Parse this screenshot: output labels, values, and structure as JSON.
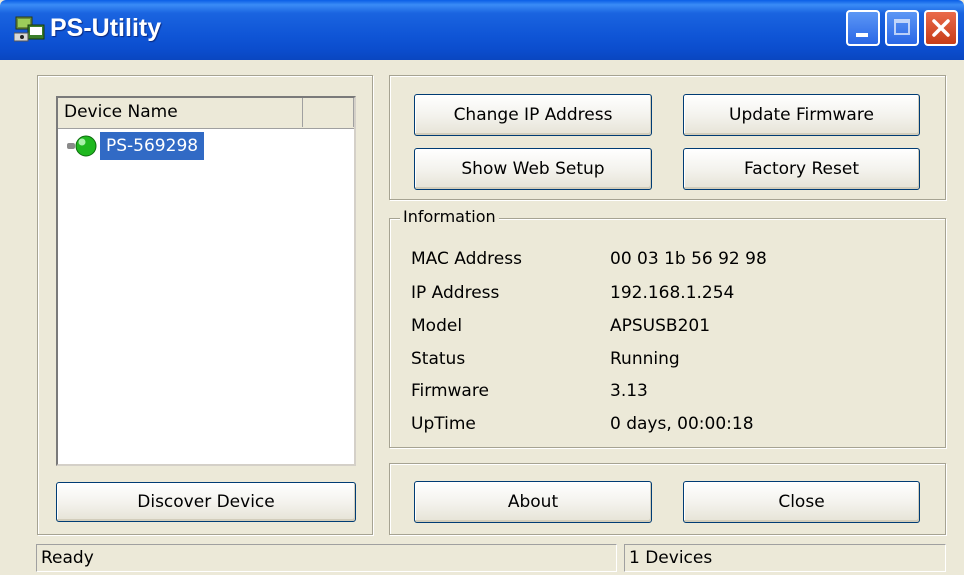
{
  "window": {
    "title": "PS-Utility",
    "icon": "printer-server-app-icon",
    "controls": [
      "minimize-icon",
      "maximize-icon",
      "close-icon"
    ]
  },
  "device_list": {
    "columns": [
      "Device Name",
      ""
    ],
    "items": [
      {
        "name": "PS-569298",
        "status_icon": "green-status-led-icon",
        "selected": true
      }
    ]
  },
  "buttons": {
    "change_ip": "Change IP Address",
    "update_firmware": "Update Firmware",
    "show_web_setup": "Show Web Setup",
    "factory_reset": "Factory Reset",
    "discover_device": "Discover Device",
    "about": "About",
    "close": "Close"
  },
  "information": {
    "title": "Information",
    "rows": [
      {
        "label": "MAC Address",
        "value": "00 03 1b 56 92 98"
      },
      {
        "label": "IP Address",
        "value": "192.168.1.254"
      },
      {
        "label": "Model",
        "value": "APSUSB201"
      },
      {
        "label": "Status",
        "value": "Running"
      },
      {
        "label": "Firmware",
        "value": "3.13"
      },
      {
        "label": "UpTime",
        "value": "0 days, 00:00:18"
      }
    ]
  },
  "status_bar": {
    "left": "Ready",
    "right": "1 Devices"
  },
  "colors": {
    "titlebar": "#0b4ccc",
    "selection": "#316ac5",
    "window_bg": "#ece9d8",
    "status_led": "#22c022"
  }
}
